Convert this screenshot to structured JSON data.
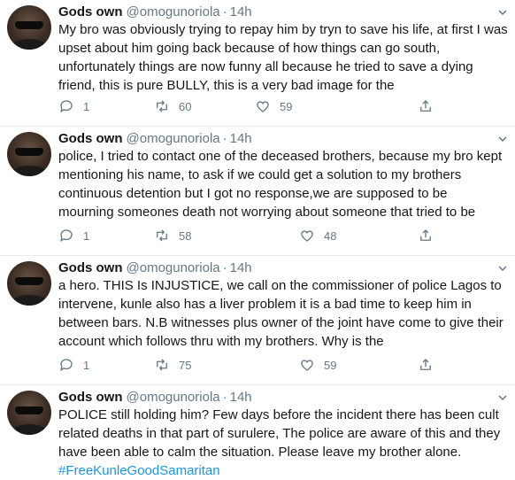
{
  "tweets": [
    {
      "name": "Gods own",
      "handle": "@omogunoriola",
      "separator": "·",
      "time": "14h",
      "text": "My bro was obviously trying to repay him by tryn to save his life, at first I was\nupset about him going back because of how things can go south,\nunfortunately things are now funny all because he tried to save a dying\nfriend, this is pure BULLY, this is a very bad image for the",
      "hashtag": "",
      "replies": "1",
      "retweets": "60",
      "likes": "59"
    },
    {
      "name": "Gods own",
      "handle": "@omogunoriola",
      "separator": "·",
      "time": "14h",
      "text": "police, I tried to contact one of the deceased brothers, because my bro kept\nmentioning his name, to ask if we could get a solution to my brothers\ncontinuous detention but I got no response,we are supposed to be\nmourning someones death not worrying about someone that tried to be",
      "hashtag": "",
      "replies": "1",
      "retweets": "58",
      "likes": "48"
    },
    {
      "name": "Gods own",
      "handle": "@omogunoriola",
      "separator": "·",
      "time": "14h",
      "text": "a hero. THIS Is INJUSTICE, we call on the commissioner of police Lagos to\nintervene, kunle also has a liver problem it is a bad time to keep him in\nbetween bars. N.B witnesses plus owner of the joint have come to give their\naccount which follows thru with my brothers. Why is the",
      "hashtag": "",
      "replies": "1",
      "retweets": "75",
      "likes": "59"
    },
    {
      "name": "Gods own",
      "handle": "@omogunoriola",
      "separator": "·",
      "time": "14h",
      "text": "POLICE still holding him? Few days before the incident there has been cult\nrelated deaths in that part of surulere, The police are aware of this and they\nhave been able to calm the situation. Please leave my brother alone.",
      "hashtag": "#FreeKunleGoodSamaritan",
      "replies": "",
      "retweets": "",
      "likes": ""
    }
  ],
  "colors": {
    "text": "#14171a",
    "secondary": "#657786",
    "link": "#1b95e0",
    "divider": "#e6ecf0"
  },
  "icons": {
    "reply": "reply-icon",
    "retweet": "retweet-icon",
    "like": "heart-icon",
    "share": "share-icon",
    "more": "chevron-down-icon"
  }
}
